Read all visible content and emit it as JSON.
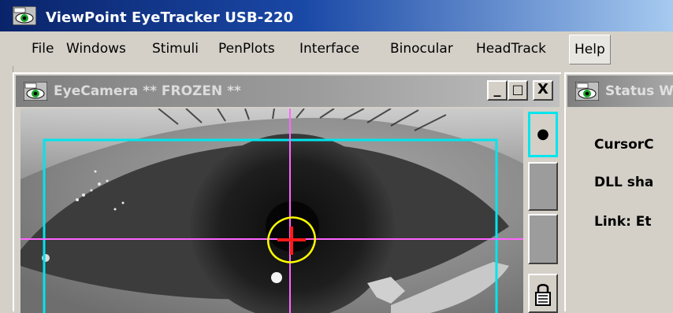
{
  "app": {
    "title": "ViewPoint EyeTracker USB-220",
    "icon": "eye-camera-icon"
  },
  "menubar": {
    "items": [
      {
        "label": "File"
      },
      {
        "label": "Windows"
      },
      {
        "label": "Stimuli"
      },
      {
        "label": "PenPlots"
      },
      {
        "label": "Interface"
      },
      {
        "label": "Binocular"
      },
      {
        "label": "HeadTrack"
      },
      {
        "label": "Help",
        "active": true
      }
    ]
  },
  "eye_camera_window": {
    "title": "EyeCamera ** FROZEN **",
    "icon": "eye-camera-icon",
    "buttons": {
      "minimize": "_",
      "maximize": "□",
      "close": "X"
    },
    "side_panel": {
      "dot_button": "●",
      "lock_icon": "lock-icon"
    },
    "overlay_colors": {
      "crosshair": "#ff66ff",
      "roi_box": "#00e5ee",
      "pupil_ellipse": "#ffff00",
      "pupil_center": "#ff1a1a"
    }
  },
  "status_window": {
    "title": "Status W",
    "icon": "eye-camera-icon",
    "lines": [
      "CursorC",
      "DLL sha",
      "Link:  Et"
    ]
  },
  "colors": {
    "titlebar_active": "#0a246a",
    "titlebar_inactive": "#808080",
    "face": "#d4d0c8"
  }
}
